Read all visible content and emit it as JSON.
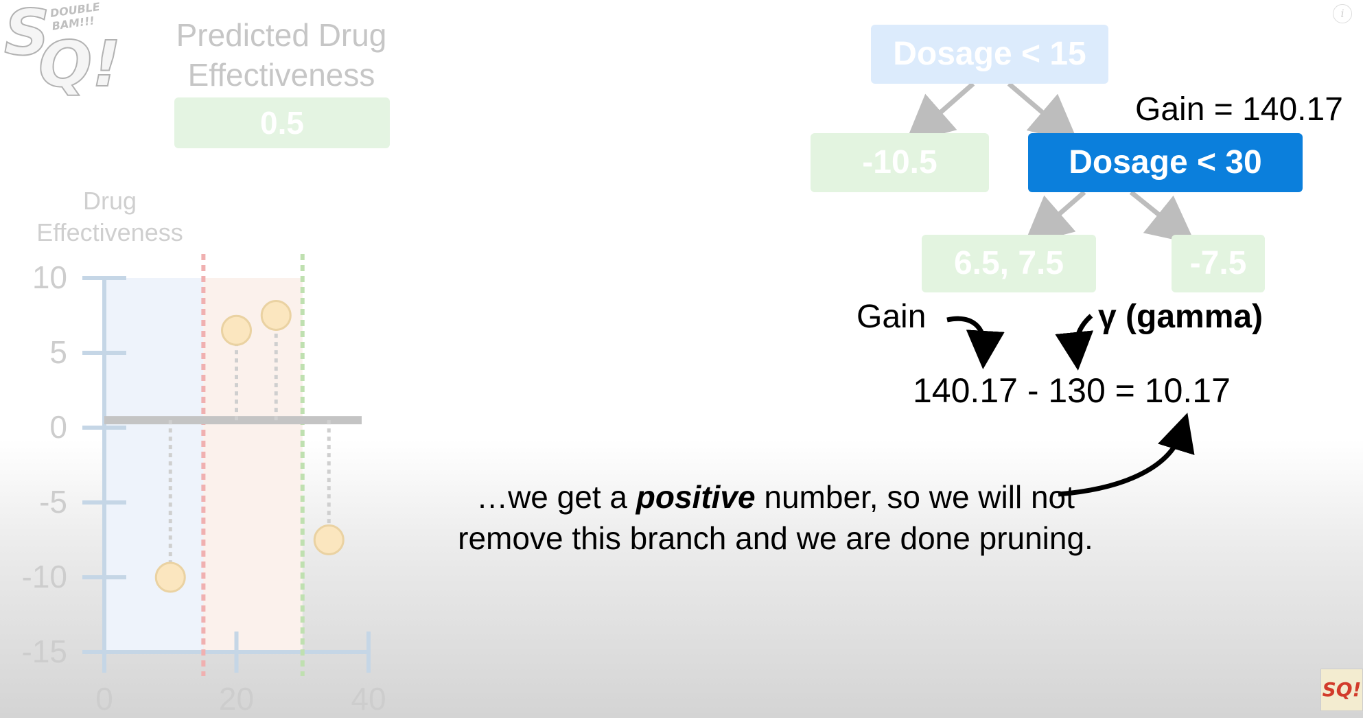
{
  "logo": {
    "letters": "SQ!",
    "tagline": "DOUBLE BAM!!!"
  },
  "info_icon": "i",
  "prediction": {
    "title": "Predicted Drug Effectiveness",
    "value": "0.5"
  },
  "tree": {
    "root": "Dosage < 15",
    "left_leaf": "-10.5",
    "right_node": "Dosage < 30",
    "right_left_leaf": "6.5, 7.5",
    "right_right_leaf": "-7.5",
    "gain_label": "Gain = 140.17"
  },
  "formula": {
    "gain_word": "Gain",
    "gamma_label": "γ (gamma)",
    "equation": "140.17 - 130 = 10.17"
  },
  "caption": {
    "part1": "…we get a ",
    "emphasis": "positive",
    "part2": " number, so we will not remove this branch and we are done pruning."
  },
  "chart_data": {
    "type": "scatter",
    "ylabel": "Drug Effectiveness",
    "xlabel": "",
    "xlim": [
      0,
      40
    ],
    "ylim": [
      -15,
      10
    ],
    "x_ticks": [
      0,
      20,
      40
    ],
    "y_ticks": [
      10,
      5,
      0,
      -5,
      -10,
      -15
    ],
    "prediction_line": 0.5,
    "thresholds": [
      {
        "x": 15,
        "color": "#f0b0b0"
      },
      {
        "x": 30,
        "color": "#bfe0b0"
      }
    ],
    "points": [
      {
        "x": 10,
        "y": -10
      },
      {
        "x": 20,
        "y": 6.5
      },
      {
        "x": 26,
        "y": 7.5
      },
      {
        "x": 34,
        "y": -7.5
      }
    ],
    "colors": {
      "axis": "#c5d6e6",
      "point_fill": "#fbe6bf",
      "point_stroke": "#ead2a2",
      "line": "#c4c4c4"
    }
  }
}
